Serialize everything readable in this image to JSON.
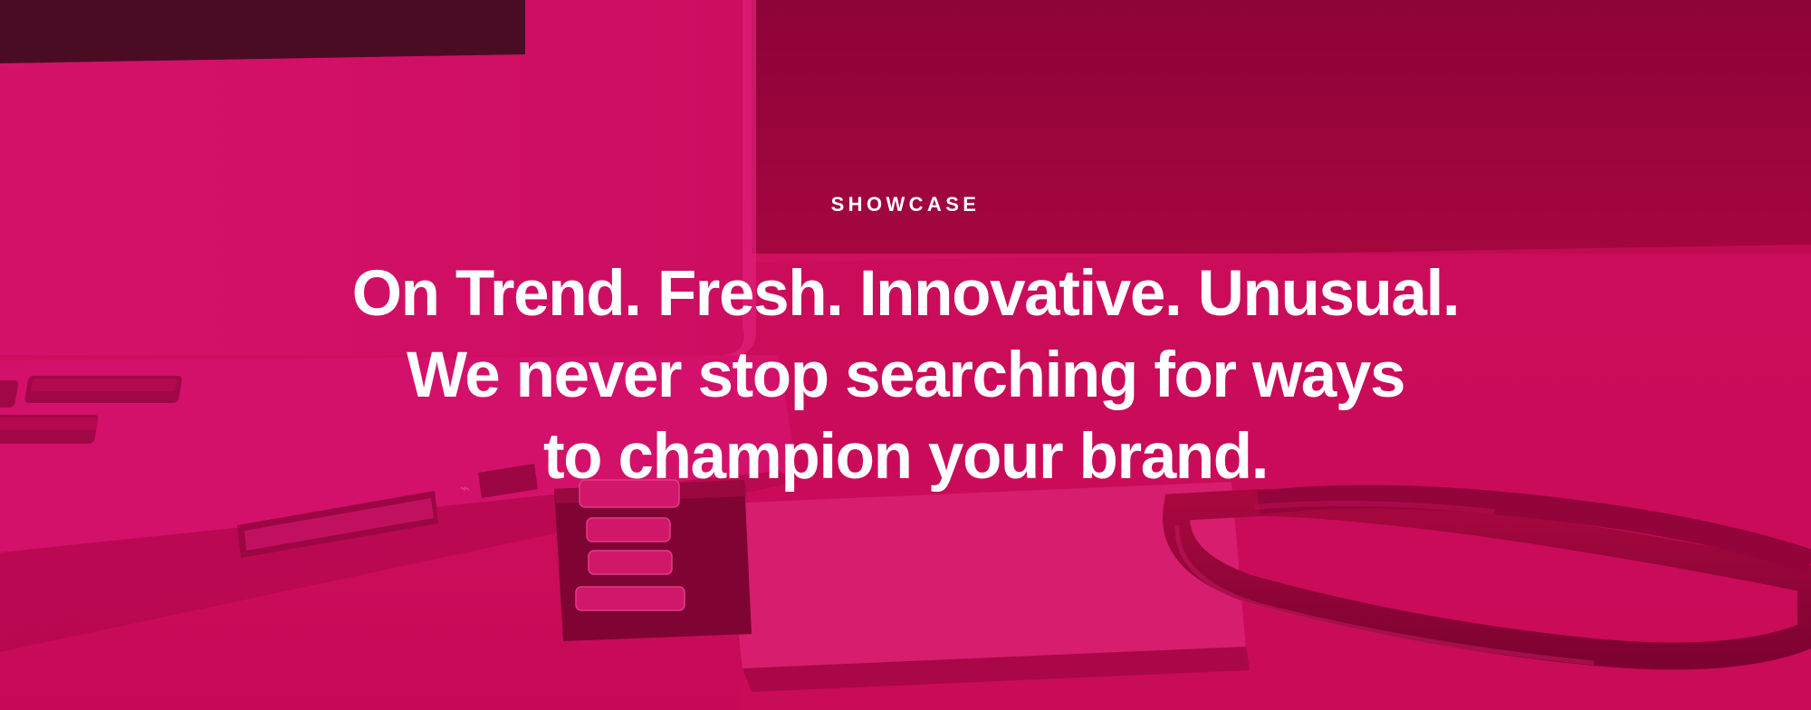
{
  "hero": {
    "eyebrow": "SHOWCASE",
    "headline_lines": [
      "On Trend. Fresh. Innovative. Unusual.",
      "We never stop searching for ways",
      "to champion your brand."
    ],
    "overlay_color": "#c80a58",
    "text_color": "#ffffff",
    "background_image": "laptop-with-usb-flash-drive"
  }
}
